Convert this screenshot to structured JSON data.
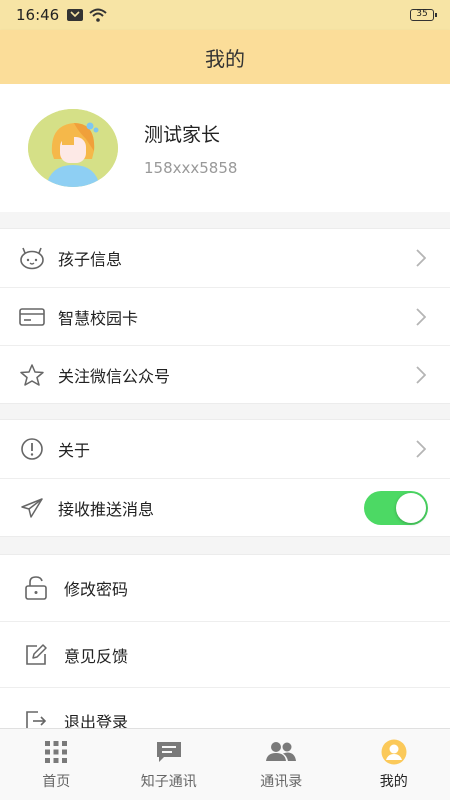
{
  "status_bar": {
    "time": "16:46",
    "battery": "35"
  },
  "header": {
    "title": "我的"
  },
  "profile": {
    "name": "测试家长",
    "phone": "158xxx5858"
  },
  "menu_group1": [
    {
      "label": "孩子信息",
      "icon": "child-face-icon"
    },
    {
      "label": "智慧校园卡",
      "icon": "card-icon"
    },
    {
      "label": "关注微信公众号",
      "icon": "star-icon"
    }
  ],
  "menu_group2": {
    "about_label": "关于",
    "push_label": "接收推送消息",
    "push_enabled": true
  },
  "menu_group3": [
    {
      "label": "修改密码",
      "icon": "unlock-icon"
    },
    {
      "label": "意见反馈",
      "icon": "edit-icon"
    },
    {
      "label": "退出登录",
      "icon": "logout-icon"
    }
  ],
  "tabs": [
    {
      "label": "首页",
      "icon": "grid-icon",
      "active": false
    },
    {
      "label": "知子通讯",
      "icon": "message-icon",
      "active": false
    },
    {
      "label": "通讯录",
      "icon": "contacts-icon",
      "active": false
    },
    {
      "label": "我的",
      "icon": "user-icon",
      "active": true
    }
  ],
  "colors": {
    "header_bg": "#fbdd99",
    "toggle_on": "#4cd964",
    "active_tab": "#fbc95a"
  }
}
